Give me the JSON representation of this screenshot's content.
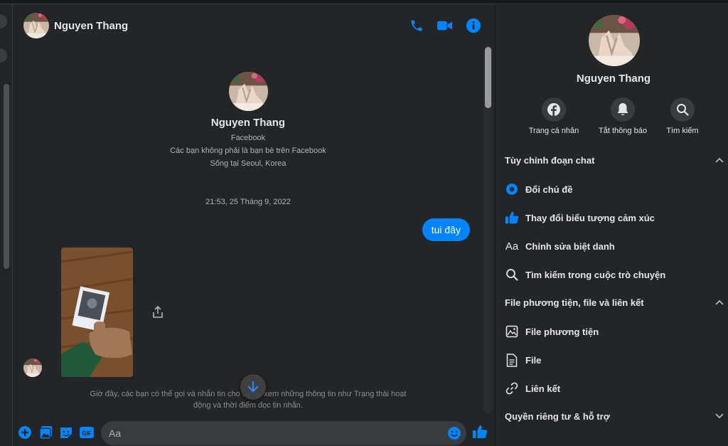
{
  "colors": {
    "accent": "#0084ff",
    "panel": "#242526",
    "background": "#18191a",
    "input": "#3a3b3c"
  },
  "header": {
    "contact_name": "Nguyen Thang",
    "icons": [
      "phone-icon",
      "video-call-icon",
      "info-icon"
    ]
  },
  "intro": {
    "name": "Nguyen Thang",
    "lines": [
      "Facebook",
      "Các bạn không phải là bạn bè trên Facebook",
      "Sống tại Seoul, Korea"
    ]
  },
  "conversation": {
    "timestamp": "21:53, 25 Tháng 9, 2022",
    "messages": [
      {
        "from": "me",
        "type": "text",
        "text": "tui đây"
      },
      {
        "from": "contact",
        "type": "photo"
      }
    ],
    "notice": "Giờ đây, các bạn có thể gọi và nhắn tin cho nhau, xem những thông tin như Trạng thái hoạt động và thời điểm đọc tin nhắn."
  },
  "composer": {
    "placeholder": "Aa",
    "icons": [
      "plus-icon",
      "image-icon",
      "sticker-icon",
      "gif-icon",
      "emoji-icon",
      "like-icon"
    ],
    "gif_label": "GIF"
  },
  "details": {
    "name": "Nguyen Thang",
    "actions": [
      {
        "label": "Trang cá nhân",
        "icon": "facebook-icon"
      },
      {
        "label": "Tắt thông báo",
        "icon": "bell-icon"
      },
      {
        "label": "Tìm kiếm",
        "icon": "search-icon"
      }
    ],
    "sections": [
      {
        "title": "Tùy chỉnh đoạn chat",
        "expanded": true,
        "items": [
          {
            "label": "Đổi chủ đề",
            "icon": "theme-icon"
          },
          {
            "label": "Thay đổi biểu tượng cảm xúc",
            "icon": "thumbs-up-icon"
          },
          {
            "label": "Chỉnh sửa biệt danh",
            "icon": "nickname-icon"
          },
          {
            "label": "Tìm kiếm trong cuộc trò chuyện",
            "icon": "search-icon"
          }
        ]
      },
      {
        "title": "File phương tiện, file và liên kết",
        "expanded": true,
        "items": [
          {
            "label": "File phương tiện",
            "icon": "media-icon"
          },
          {
            "label": "File",
            "icon": "file-icon"
          },
          {
            "label": "Liên kết",
            "icon": "link-icon"
          }
        ]
      },
      {
        "title": "Quyền riêng tư & hỗ trợ",
        "expanded": false,
        "items": []
      }
    ]
  }
}
